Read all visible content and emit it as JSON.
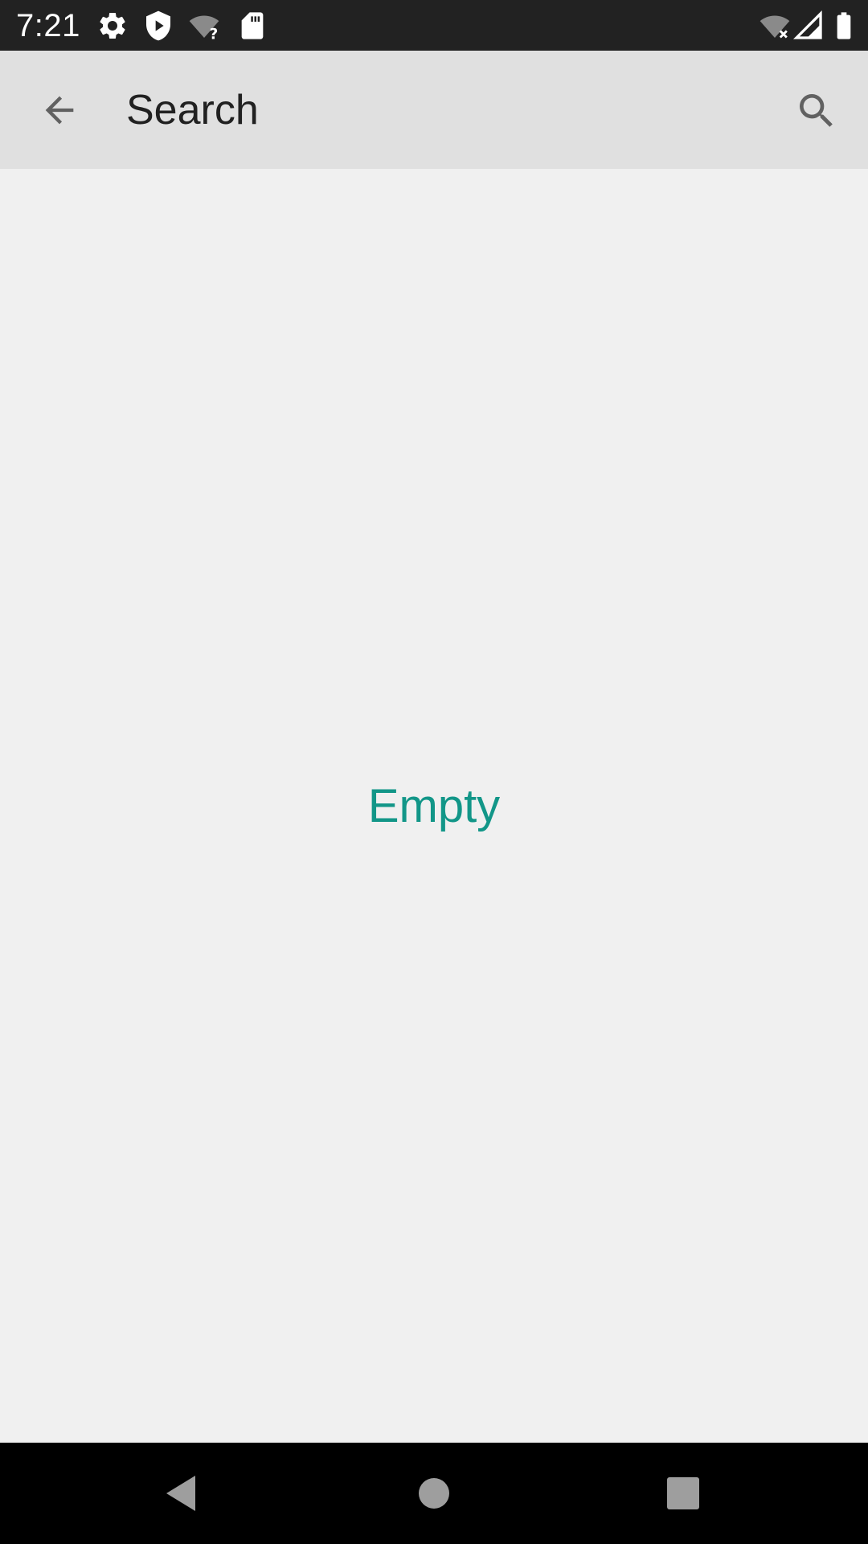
{
  "status_bar": {
    "time": "7:21",
    "left_icons": [
      "settings-icon",
      "shield-icon",
      "wifi-unknown-icon",
      "sd-card-icon"
    ],
    "right_icons": [
      "wifi-off-icon",
      "cell-signal-icon",
      "battery-icon"
    ]
  },
  "app_bar": {
    "title": "Search",
    "back_icon": "arrow-back-icon",
    "search_icon": "search-icon"
  },
  "content": {
    "empty_text": "Empty"
  },
  "nav_bar": {
    "buttons": [
      "back-triangle",
      "home-circle",
      "recents-square"
    ]
  },
  "colors": {
    "status_bar": "#222222",
    "app_bar": "#e0e0e0",
    "background": "#f0f0f0",
    "accent": "#129688",
    "nav_bar": "#000000"
  }
}
